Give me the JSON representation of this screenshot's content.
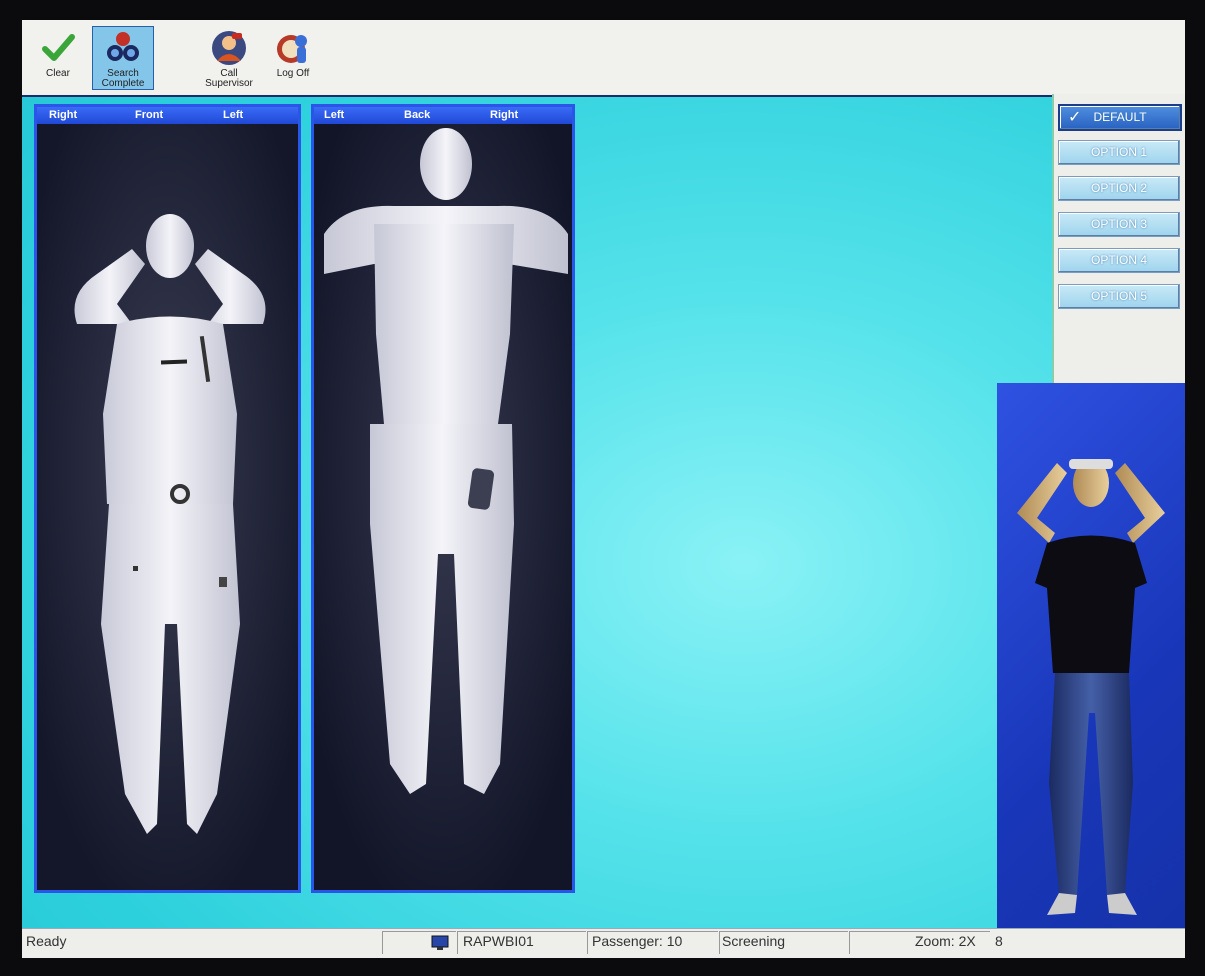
{
  "toolbar": {
    "clear_label": "Clear",
    "search_complete_label_1": "Search",
    "search_complete_label_2": "Complete",
    "call_supervisor_label_1": "Call",
    "call_supervisor_label_2": "Supervisor",
    "log_off_label": "Log Off"
  },
  "front_panel": {
    "col1": "Right",
    "col2": "Front",
    "col3": "Left"
  },
  "back_panel": {
    "col1": "Left",
    "col2": "Back",
    "col3": "Right"
  },
  "options": {
    "items": [
      {
        "label": "DEFAULT",
        "selected": true
      },
      {
        "label": "OPTION 1",
        "selected": false
      },
      {
        "label": "OPTION 2",
        "selected": false
      },
      {
        "label": "OPTION 3",
        "selected": false
      },
      {
        "label": "OPTION 4",
        "selected": false
      },
      {
        "label": "OPTION 5",
        "selected": false
      }
    ]
  },
  "status": {
    "ready": "Ready",
    "station": "RAPWBI01",
    "passenger": "Passenger: 10",
    "mode": "Screening",
    "zoom": "Zoom: 2X",
    "extra": "8"
  },
  "colors": {
    "background": "#2fd3dc",
    "panel_border": "#2b54e8",
    "header_blue": "#3a6cf6",
    "selected_option": "#2962c2"
  },
  "icons": [
    "checkmark-icon",
    "binoculars-icon",
    "supervisor-icon",
    "log-off-icon",
    "monitor-icon",
    "check-icon"
  ]
}
